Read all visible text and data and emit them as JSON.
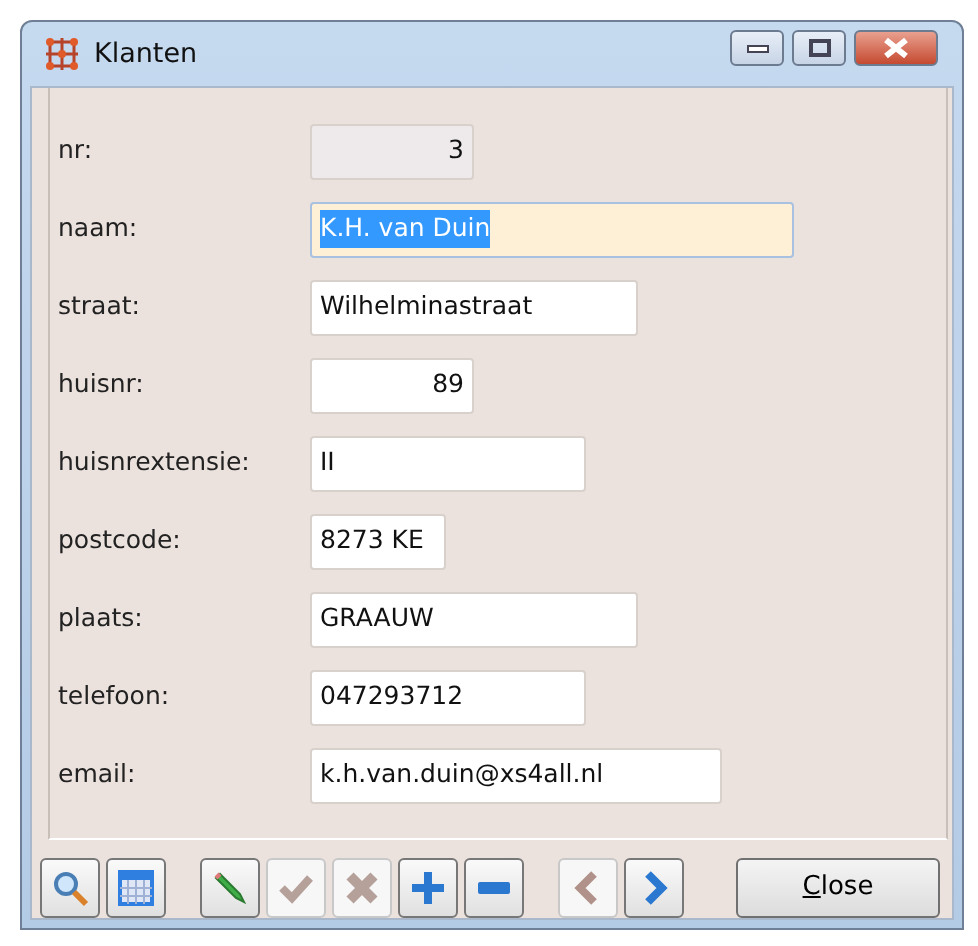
{
  "window": {
    "title": "Klanten"
  },
  "fields": [
    {
      "label": "nr:",
      "value": "3",
      "disabled": true,
      "focused": false
    },
    {
      "label": "naam:",
      "value": "K.H. van Duin",
      "disabled": false,
      "focused": true
    },
    {
      "label": "straat:",
      "value": "Wilhelminastraat",
      "disabled": false,
      "focused": false
    },
    {
      "label": "huisnr:",
      "value": "89",
      "disabled": false,
      "focused": false
    },
    {
      "label": "huisnrextensie:",
      "value": "II",
      "disabled": false,
      "focused": false
    },
    {
      "label": "postcode:",
      "value": "8273 KE",
      "disabled": false,
      "focused": false
    },
    {
      "label": "plaats:",
      "value": "GRAAUW",
      "disabled": false,
      "focused": false
    },
    {
      "label": "telefoon:",
      "value": "047293712",
      "disabled": false,
      "focused": false
    },
    {
      "label": "email:",
      "value": "k.h.van.duin@xs4all.nl",
      "disabled": false,
      "focused": false
    }
  ],
  "toolbar": [
    {
      "kind": "search",
      "disabled": false
    },
    {
      "kind": "grid",
      "disabled": false
    },
    {
      "kind": "edit",
      "disabled": false
    },
    {
      "kind": "check",
      "disabled": true
    },
    {
      "kind": "cancel",
      "disabled": true
    },
    {
      "kind": "add",
      "disabled": false
    },
    {
      "kind": "remove",
      "disabled": false
    },
    {
      "kind": "prev",
      "disabled": true
    },
    {
      "kind": "next",
      "disabled": false
    }
  ],
  "close_button": {
    "label": "Close"
  }
}
